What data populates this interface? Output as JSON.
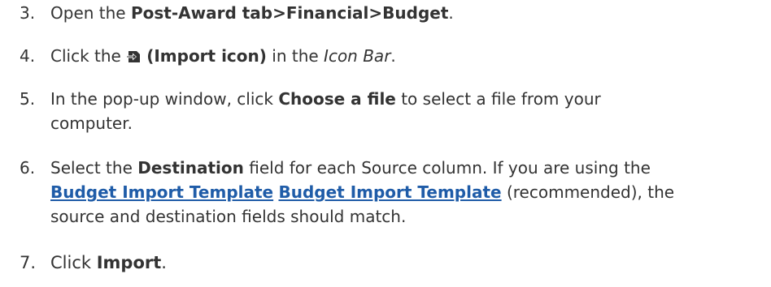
{
  "steps": [
    {
      "number": "3.",
      "text_1": "Open the ",
      "bold_1": "Post-Award tab>Financial>Budget",
      "text_2": "."
    },
    {
      "number": "4.",
      "text_1": "Click the ",
      "icon": "import-icon",
      "bold_1": "(Import icon)",
      "text_2": " in the ",
      "italic_1": "Icon Bar",
      "text_3": "."
    },
    {
      "number": "5.",
      "text_1": "In the pop-up window, click ",
      "bold_1": "Choose a file",
      "text_2": " to select a file from your",
      "text_3": "computer."
    },
    {
      "number": "6.",
      "text_1": "Select the ",
      "bold_1": "Destination",
      "text_2": " field for each Source column. If you are using the",
      "link_1": "Budget Import Template",
      "link_2": "Budget Import Template",
      "text_3": " (recommended), the",
      "text_4": "source and destination fields should match."
    },
    {
      "number": "7.",
      "text_1": "Click ",
      "bold_1": "Import",
      "text_2": "."
    }
  ],
  "colors": {
    "text": "#333333",
    "link": "#1f5ca8"
  }
}
